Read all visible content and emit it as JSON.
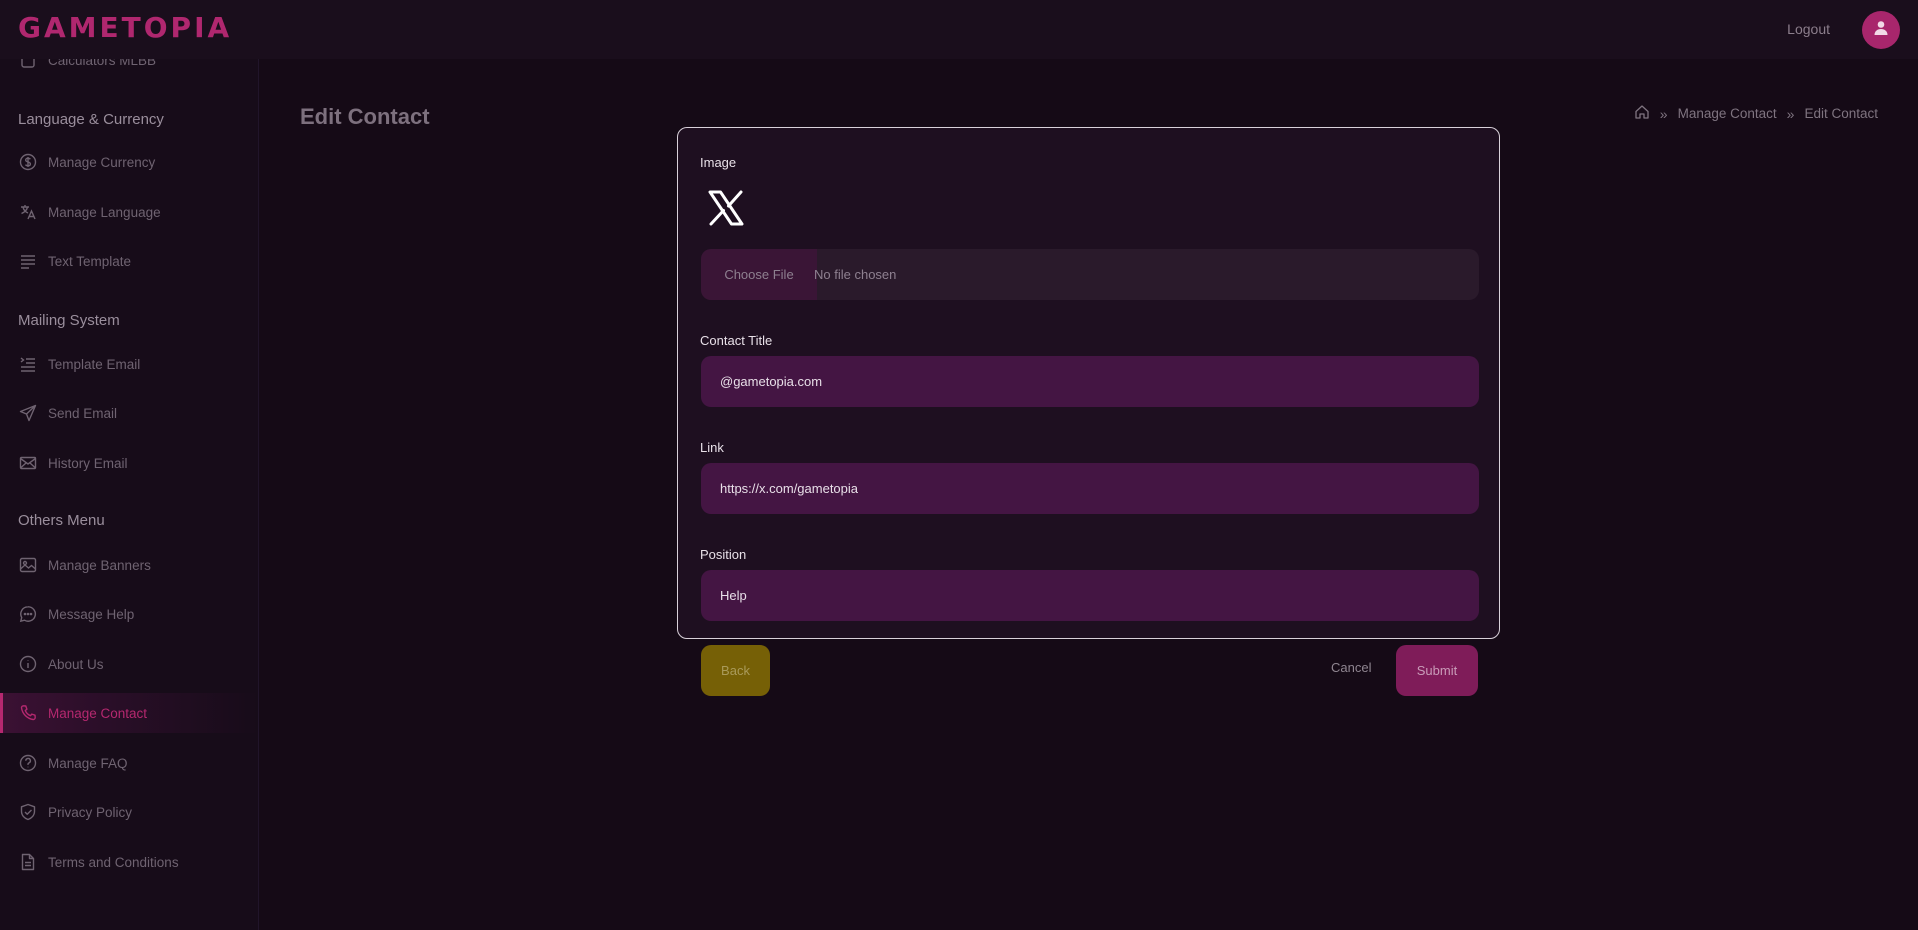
{
  "brand": {
    "logo_text": "GAMETOPIA",
    "accent_color": "#b0276f"
  },
  "header": {
    "logout_label": "Logout",
    "avatar_icon": "user-icon"
  },
  "sidebar": {
    "partial_item": {
      "label": "Calculators MLBB",
      "icon": "calculator-icon"
    },
    "sections": [
      {
        "heading": "Language & Currency",
        "items": [
          {
            "label": "Manage Currency",
            "icon": "dollar-circle-icon"
          },
          {
            "label": "Manage Language",
            "icon": "translate-icon"
          },
          {
            "label": "Text Template",
            "icon": "text-lines-icon"
          }
        ]
      },
      {
        "heading": "Mailing System",
        "items": [
          {
            "label": "Template Email",
            "icon": "list-indent-icon"
          },
          {
            "label": "Send Email",
            "icon": "paper-plane-icon"
          },
          {
            "label": "History Email",
            "icon": "envelope-icon"
          }
        ]
      },
      {
        "heading": "Others Menu",
        "items": [
          {
            "label": "Manage Banners",
            "icon": "image-icon"
          },
          {
            "label": "Message Help",
            "icon": "chat-bubble-icon"
          },
          {
            "label": "About Us",
            "icon": "info-circle-icon"
          },
          {
            "label": "Manage Contact",
            "icon": "phone-icon",
            "active": true
          },
          {
            "label": "Manage FAQ",
            "icon": "question-circle-icon"
          },
          {
            "label": "Privacy Policy",
            "icon": "shield-check-icon"
          },
          {
            "label": "Terms and Conditions",
            "icon": "document-icon"
          }
        ]
      }
    ]
  },
  "page": {
    "title": "Edit Contact",
    "breadcrumb": {
      "home_icon": "home-icon",
      "items": [
        "Manage Contact",
        "Edit Contact"
      ]
    }
  },
  "form": {
    "image": {
      "label": "Image",
      "preview_icon": "x-logo-icon",
      "choose_file_label": "Choose File",
      "file_status": "No file chosen"
    },
    "contact_title": {
      "label": "Contact Title",
      "value": "@gametopia.com"
    },
    "link": {
      "label": "Link",
      "value": "https://x.com/gametopia"
    },
    "position": {
      "label": "Position",
      "value": "Help"
    }
  },
  "actions": {
    "back_label": "Back",
    "cancel_label": "Cancel",
    "submit_label": "Submit"
  }
}
